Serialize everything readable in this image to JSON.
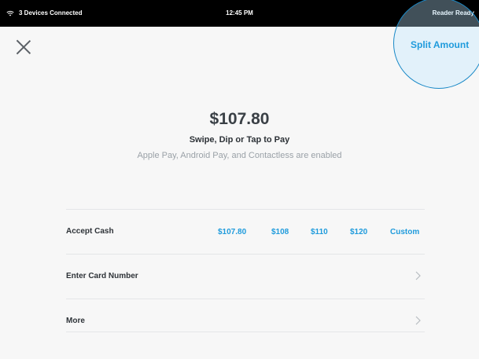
{
  "status_bar": {
    "connection": "3 Devices Connected",
    "time": "12:45 PM",
    "reader": "Reader Ready"
  },
  "header": {
    "split_label": "Split Amount"
  },
  "payment": {
    "amount": "$107.80",
    "instruction": "Swipe, Dip or Tap to Pay",
    "methods_note": "Apple Pay, Android Pay, and Contactless are enabled"
  },
  "options": {
    "cash_label": "Accept Cash",
    "cash_amounts": [
      "$107.80",
      "$108",
      "$110",
      "$120",
      "Custom"
    ],
    "card_label": "Enter Card Number",
    "more_label": "More"
  },
  "colors": {
    "accent": "#1f9bdc",
    "highlight_border": "#1a89c7"
  }
}
